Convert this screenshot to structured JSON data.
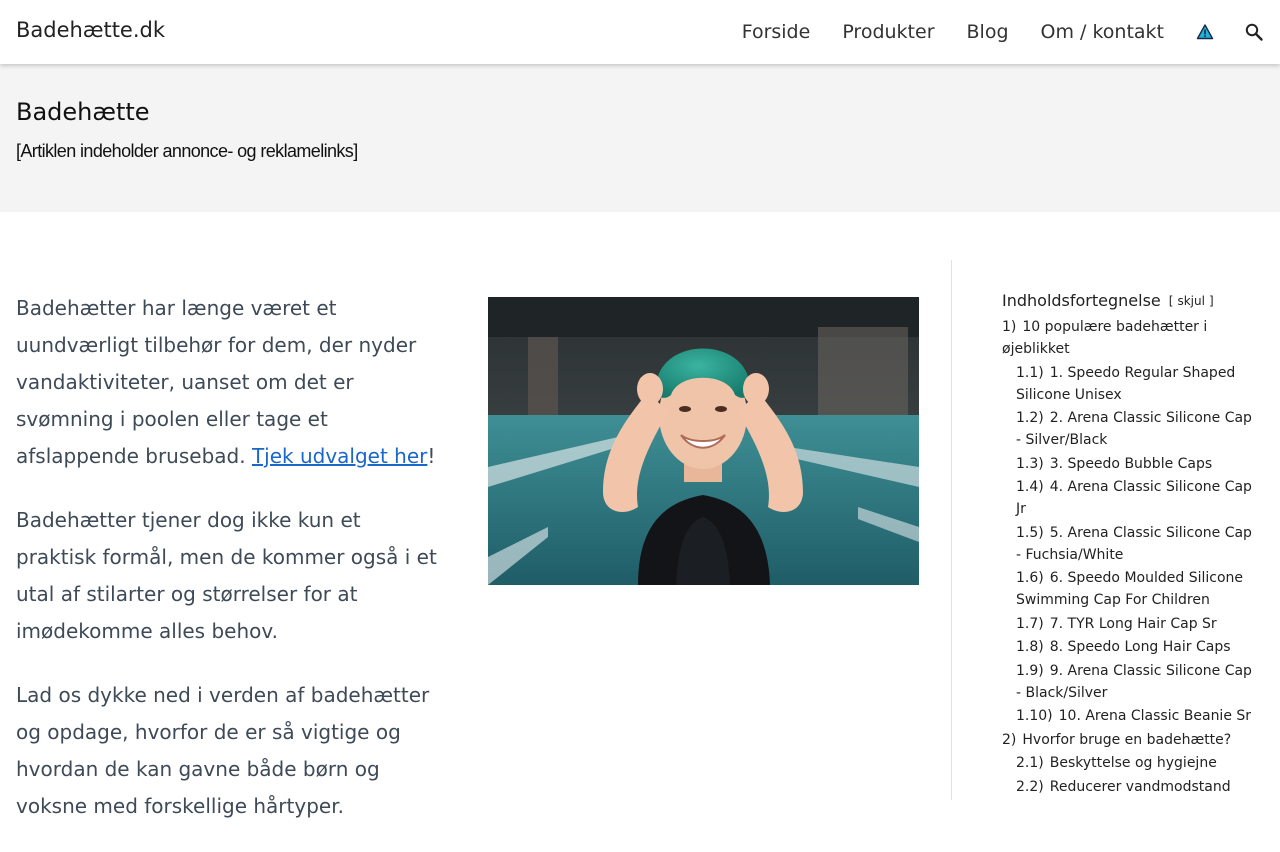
{
  "header": {
    "brand": "Badehætte.dk",
    "nav": [
      "Forside",
      "Produkter",
      "Blog",
      "Om / kontakt"
    ],
    "icons": [
      "warning-triangle-icon",
      "search-icon"
    ]
  },
  "hero": {
    "title": "Badehætte",
    "note": "[Artiklen indeholder annonce- og reklamelinks]"
  },
  "content": {
    "p1_text": "Badehætter har længe været et uundværligt tilbehør for dem, der nyder vandaktiviteter, uanset om det er svømning i poolen eller tage et afslappende brusebad. ",
    "p1_link": "Tjek udvalget her",
    "p1_end": "!",
    "p2": "Badehætter tjener dog ikke kun et praktisk formål, men de kommer også i et utal af stilarter og størrelser for at imødekomme alles behov.",
    "p3": "Lad os dykke ned i verden af badehætter og opdage, hvorfor de er så vigtige og hvordan de kan gavne både børn og voksne med forskellige hårtyper."
  },
  "toc": {
    "title": "Indholdsfortegnelse",
    "toggle_open": "[",
    "toggle_label": "skjul",
    "toggle_close": "]",
    "items": [
      {
        "num": "1)",
        "text": "10 populære badehætter i øjeblikket",
        "level": 1
      },
      {
        "num": "1.1)",
        "text": "1. Speedo Regular Shaped Silicone Unisex",
        "level": 2
      },
      {
        "num": "1.2)",
        "text": "2. Arena Classic Silicone Cap - Silver/Black",
        "level": 2
      },
      {
        "num": "1.3)",
        "text": "3. Speedo Bubble Caps",
        "level": 2
      },
      {
        "num": "1.4)",
        "text": "4. Arena Classic Silicone Cap Jr",
        "level": 2
      },
      {
        "num": "1.5)",
        "text": "5. Arena Classic Silicone Cap - Fuchsia/White",
        "level": 2
      },
      {
        "num": "1.6)",
        "text": "6. Speedo Moulded Silicone Swimming Cap For Children",
        "level": 2
      },
      {
        "num": "1.7)",
        "text": "7. TYR Long Hair Cap Sr",
        "level": 2
      },
      {
        "num": "1.8)",
        "text": "8. Speedo Long Hair Caps",
        "level": 2
      },
      {
        "num": "1.9)",
        "text": "9. Arena Classic Silicone Cap - Black/Silver",
        "level": 2
      },
      {
        "num": "1.10)",
        "text": "10. Arena Classic Beanie Sr",
        "level": 2
      },
      {
        "num": "2)",
        "text": "Hvorfor bruge en badehætte?",
        "level": 1
      },
      {
        "num": "2.1)",
        "text": "Beskyttelse og hygiejne",
        "level": 2
      },
      {
        "num": "2.2)",
        "text": "Reducerer vandmodstand",
        "level": 2
      }
    ]
  },
  "colors": {
    "link": "#1a66c9",
    "body_text": "#3e4a57",
    "hero_bg": "#f4f4f4"
  }
}
